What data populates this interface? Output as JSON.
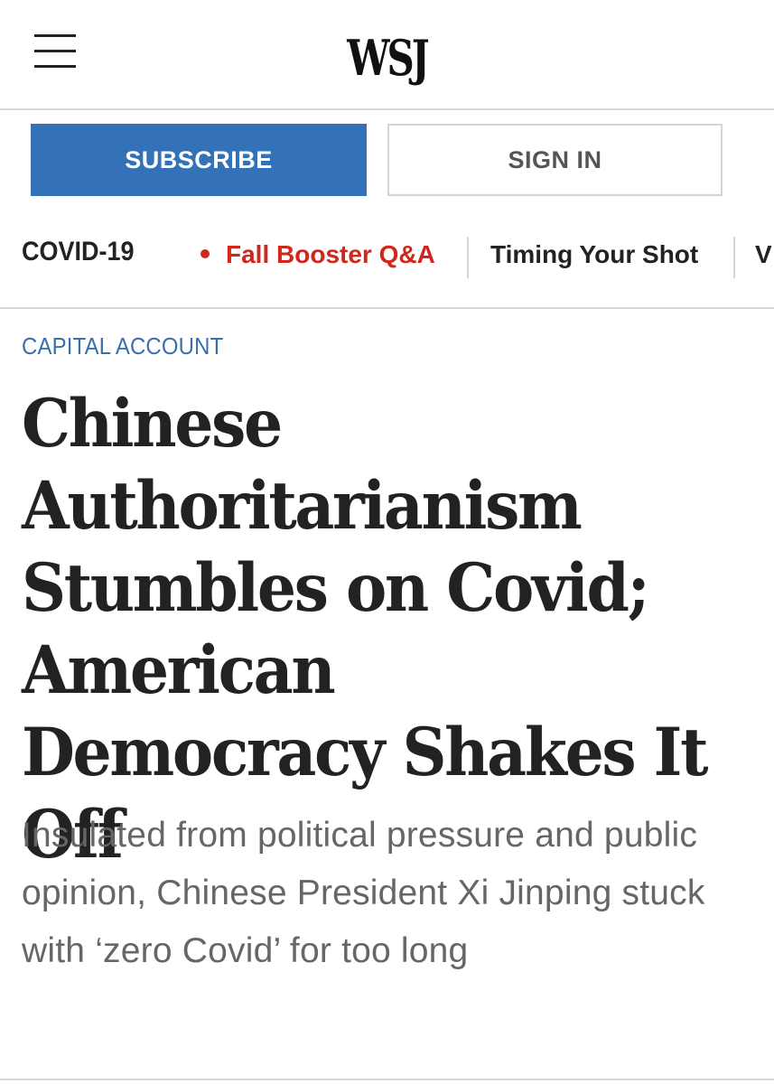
{
  "header": {
    "logo_text": "WSJ",
    "menu_icon": "hamburger-menu-icon"
  },
  "auth": {
    "subscribe_label": "SUBSCRIBE",
    "signin_label": "SIGN IN",
    "subscribe_color": "#3371b9"
  },
  "topic_nav": {
    "topic": "COVID-19",
    "links": [
      {
        "label": "Fall Booster Q&A",
        "live": true,
        "color": "#d0261c"
      },
      {
        "label": "Timing Your Shot",
        "live": false
      },
      {
        "label": "V",
        "live": false
      }
    ]
  },
  "article": {
    "flashline": "CAPITAL ACCOUNT",
    "headline": "Chinese Authoritarianism Stumbles on Covid; American Democracy Shakes It Off",
    "dek": "Insulated from political pressure and public opinion, Chinese President Xi Jinping stuck with ‘zero Covid’ for too long"
  }
}
